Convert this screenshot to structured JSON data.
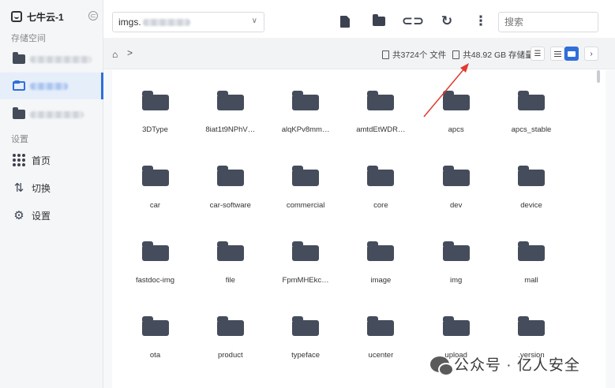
{
  "sidebar": {
    "app_title": "七牛云-1",
    "collapse_icon": "collapse-icon",
    "storage_label": "存储空间",
    "settings_label": "设置",
    "nav": [
      {
        "label": "首页",
        "icon": "grid-dots-icon"
      },
      {
        "label": "切换",
        "icon": "toggle-icon"
      },
      {
        "label": "设置",
        "icon": "gear-icon"
      }
    ]
  },
  "toolbar": {
    "bucket_select_value": "imgs.",
    "search_placeholder": "搜索",
    "icons": [
      "new-file-icon",
      "new-folder-icon",
      "link-icon",
      "refresh-icon",
      "more-icon"
    ]
  },
  "breadcrumb": {
    "home_icon": "home-icon",
    "separator": ">"
  },
  "stats": {
    "files_text": "共3724个 文件",
    "storage_text": "共48.92 GB 存储量"
  },
  "accent_color": "#2f6fd8",
  "annotation_color": "#e03a2f",
  "folders": [
    "3DType",
    "8iat1t9NPhV…",
    "alqKPv8mm…",
    "amtdEtWDR…",
    "apcs",
    "apcs_stable",
    "car",
    "car-software",
    "commercial",
    "core",
    "dev",
    "device",
    "fastdoc-img",
    "file",
    "FpmMHEkc…",
    "image",
    "img",
    "mall",
    "ota",
    "product",
    "typeface",
    "ucenter",
    "upload",
    ".version"
  ],
  "watermark": "公众号 · 亿人安全"
}
